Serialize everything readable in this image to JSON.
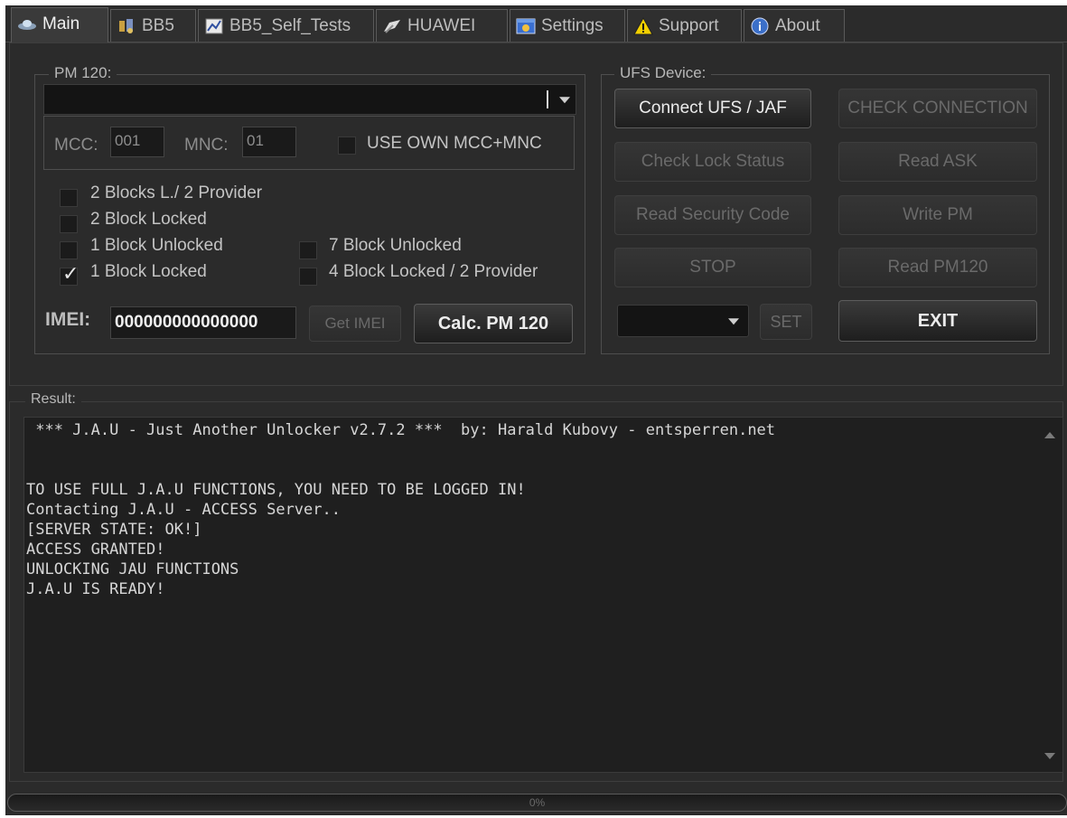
{
  "tabs": [
    {
      "label": "Main",
      "icon": "ufo-icon",
      "active": true
    },
    {
      "label": "BB5",
      "icon": "tools-icon",
      "active": false
    },
    {
      "label": "BB5_Self_Tests",
      "icon": "chart-icon",
      "active": false
    },
    {
      "label": "HUAWEI",
      "icon": "flag-icon",
      "active": false
    },
    {
      "label": "Settings",
      "icon": "settings-window-icon",
      "active": false
    },
    {
      "label": "Support",
      "icon": "warning-icon",
      "active": false
    },
    {
      "label": "About",
      "icon": "info-globe-icon",
      "active": false
    }
  ],
  "pm120": {
    "title": "PM 120:",
    "provider_value": "",
    "mcc_label": "MCC:",
    "mcc_value": "001",
    "mnc_label": "MNC:",
    "mnc_value": "01",
    "use_own_label": "USE OWN MCC+MNC"
  },
  "lock_options": [
    {
      "label": "2 Blocks L./ 2 Provider",
      "checked": false
    },
    {
      "label": "2 Block Locked",
      "checked": false
    },
    {
      "label": "1 Block Unlocked",
      "checked": false
    },
    {
      "label": "7 Block Unlocked",
      "checked": false
    },
    {
      "label": "1 Block Locked",
      "checked": true
    },
    {
      "label": "4 Block Locked / 2 Provider",
      "checked": false
    }
  ],
  "imei": {
    "label": "IMEI:",
    "value": "000000000000000",
    "get_button": "Get IMEI",
    "calc_button": "Calc. PM 120"
  },
  "ufs": {
    "title": "UFS Device:",
    "connect": "Connect UFS / JAF",
    "check_connection": "CHECK CONNECTION",
    "check_lock": "Check Lock Status",
    "read_ask": "Read ASK",
    "read_security": "Read Security Code",
    "write_pm": "Write PM",
    "stop": "STOP",
    "read_pm120": "Read PM120",
    "set": "SET",
    "exit": "EXIT",
    "port_value": ""
  },
  "result": {
    "title": "Result:",
    "lines": [
      " *** J.A.U - Just Another Unlocker v2.7.2 ***  by: Harald Kubovy - entsperren.net",
      "",
      "",
      "TO USE FULL J.A.U FUNCTIONS, YOU NEED TO BE LOGGED IN!",
      "Contacting J.A.U - ACCESS Server..",
      "[SERVER STATE: OK!]",
      "ACCESS GRANTED!",
      "UNLOCKING JAU FUNCTIONS",
      "J.A.U IS READY!"
    ]
  },
  "progress": {
    "value": 0,
    "label": "0%"
  }
}
